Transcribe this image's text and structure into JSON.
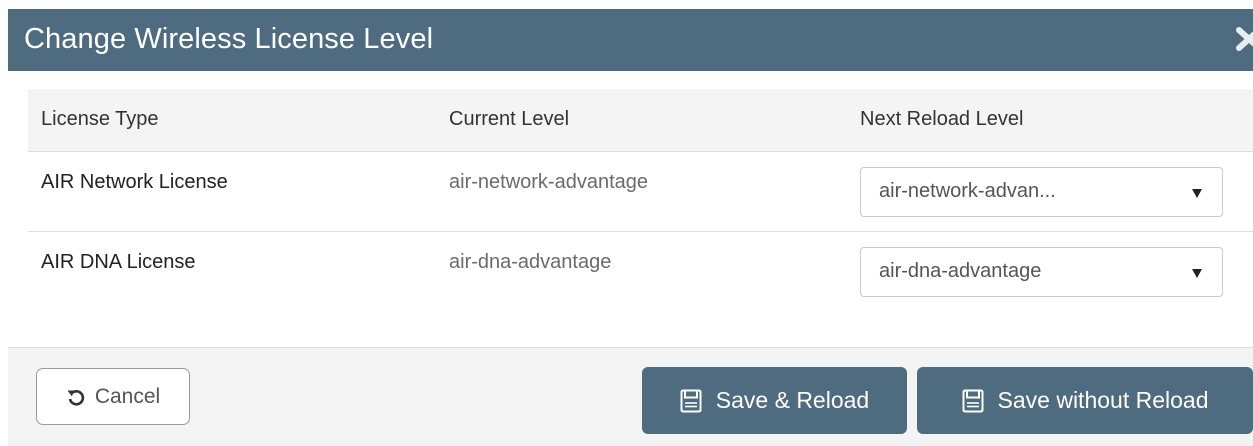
{
  "dialog": {
    "title": "Change Wireless License Level",
    "close_icon": "close-icon"
  },
  "table": {
    "headers": [
      "License Type",
      "Current Level",
      "Next Reload Level"
    ],
    "rows": [
      {
        "license_type": "AIR Network License",
        "current_level": "air-network-advantage",
        "next_reload_level": "air-network-advan..."
      },
      {
        "license_type": "AIR DNA License",
        "current_level": "air-dna-advantage",
        "next_reload_level": "air-dna-advantage"
      }
    ]
  },
  "footer": {
    "cancel_label": "Cancel",
    "cancel_icon": "undo-icon",
    "save_reload_label": "Save & Reload",
    "save_without_reload_label": "Save without Reload",
    "save_icon": "save-icon"
  },
  "colors": {
    "header_bg": "#4f6b80",
    "primary_button_bg": "#4f6b80",
    "footer_bg": "#f3f3f3",
    "table_header_bg": "#f4f4f4"
  }
}
